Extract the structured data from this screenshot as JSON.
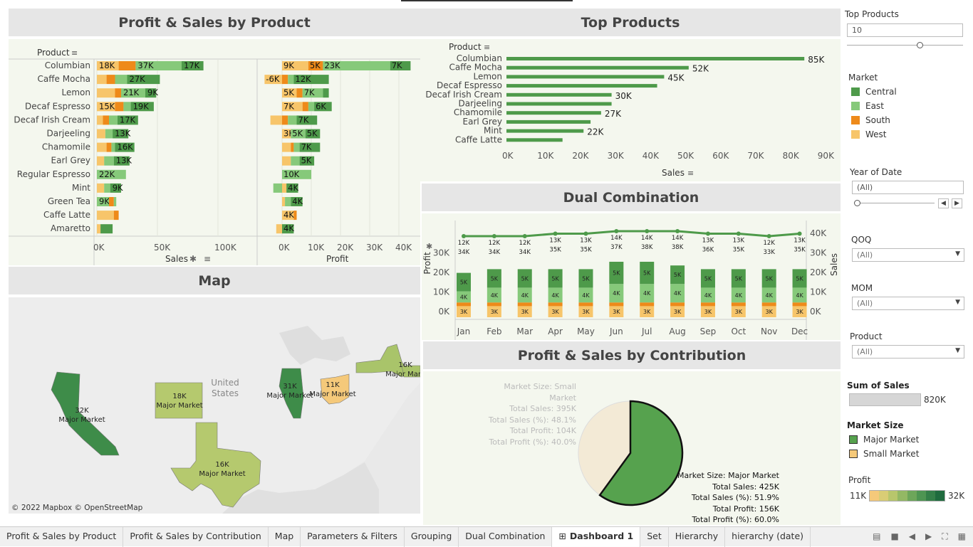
{
  "colors": {
    "central": "#4e9a4a",
    "east": "#86c97a",
    "south": "#ee8a1a",
    "west": "#f7c56a",
    "panel": "#f4f7ee",
    "title_bg": "#e6e6e6",
    "line": "#4e9a4a",
    "major": "#56a24e",
    "small": "#f3ead6"
  },
  "titles": {
    "profit_sales": "Profit & Sales by Product",
    "top_products": "Top Products",
    "map": "Map",
    "dual": "Dual Combination",
    "contribution": "Profit & Sales by Contribution"
  },
  "ps": {
    "product_header": "Product",
    "sales_axis": "Sales",
    "profit_axis": "Profit",
    "sales_ticks": [
      "0K",
      "50K",
      "100K"
    ],
    "profit_ticks": [
      "0K",
      "10K",
      "20K",
      "30K",
      "40K"
    ],
    "products": [
      {
        "name": "Columbian",
        "sales": [
          {
            "m": "west",
            "v": 18,
            "l": "18K"
          },
          {
            "m": "south",
            "v": 14,
            "l": ""
          },
          {
            "m": "east",
            "v": 38,
            "l": "37K"
          },
          {
            "m": "central",
            "v": 18,
            "l": "17K"
          }
        ],
        "profit": [
          {
            "m": "west",
            "v": 9,
            "l": "9K"
          },
          {
            "m": "south",
            "v": 5,
            "l": "5K"
          },
          {
            "m": "east",
            "v": 23,
            "l": "23K"
          },
          {
            "m": "central",
            "v": 7,
            "l": "7K"
          }
        ]
      },
      {
        "name": "Caffe Mocha",
        "sales": [
          {
            "m": "west",
            "v": 8,
            "l": ""
          },
          {
            "m": "south",
            "v": 7,
            "l": ""
          },
          {
            "m": "east",
            "v": 10,
            "l": ""
          },
          {
            "m": "central",
            "v": 27,
            "l": "27K"
          }
        ],
        "profit": [
          {
            "m": "west",
            "v": -6,
            "l": "-6K"
          },
          {
            "m": "south",
            "v": 2,
            "l": ""
          },
          {
            "m": "east",
            "v": 2,
            "l": ""
          },
          {
            "m": "central",
            "v": 12,
            "l": "12K"
          }
        ]
      },
      {
        "name": "Lemon",
        "sales": [
          {
            "m": "west",
            "v": 15,
            "l": ""
          },
          {
            "m": "south",
            "v": 5,
            "l": ""
          },
          {
            "m": "east",
            "v": 20,
            "l": "21K"
          },
          {
            "m": "central",
            "v": 9,
            "l": "9K"
          }
        ],
        "profit": [
          {
            "m": "west",
            "v": 5,
            "l": "5K"
          },
          {
            "m": "south",
            "v": 2,
            "l": ""
          },
          {
            "m": "east",
            "v": 7,
            "l": "7K"
          },
          {
            "m": "central",
            "v": 2,
            "l": ""
          }
        ]
      },
      {
        "name": "Decaf Espresso",
        "sales": [
          {
            "m": "west",
            "v": 15,
            "l": "15K"
          },
          {
            "m": "south",
            "v": 7,
            "l": ""
          },
          {
            "m": "east",
            "v": 6,
            "l": ""
          },
          {
            "m": "central",
            "v": 19,
            "l": "19K"
          }
        ],
        "profit": [
          {
            "m": "west",
            "v": 7,
            "l": "7K"
          },
          {
            "m": "south",
            "v": 2,
            "l": ""
          },
          {
            "m": "east",
            "v": 2,
            "l": ""
          },
          {
            "m": "central",
            "v": 6,
            "l": "6K"
          }
        ]
      },
      {
        "name": "Decaf Irish Cream",
        "sales": [
          {
            "m": "west",
            "v": 5,
            "l": ""
          },
          {
            "m": "south",
            "v": 5,
            "l": ""
          },
          {
            "m": "east",
            "v": 7,
            "l": ""
          },
          {
            "m": "central",
            "v": 17,
            "l": "17K"
          }
        ],
        "profit": [
          {
            "m": "west",
            "v": -4,
            "l": ""
          },
          {
            "m": "south",
            "v": 2,
            "l": ""
          },
          {
            "m": "east",
            "v": 3,
            "l": ""
          },
          {
            "m": "central",
            "v": 7,
            "l": "7K"
          }
        ]
      },
      {
        "name": "Darjeeling",
        "sales": [
          {
            "m": "west",
            "v": 7,
            "l": ""
          },
          {
            "m": "east",
            "v": 6,
            "l": ""
          },
          {
            "m": "central",
            "v": 13,
            "l": "13K"
          }
        ],
        "profit": [
          {
            "m": "west",
            "v": 3,
            "l": "3K"
          },
          {
            "m": "east",
            "v": 5,
            "l": "5K"
          },
          {
            "m": "central",
            "v": 5,
            "l": "5K"
          }
        ]
      },
      {
        "name": "Chamomile",
        "sales": [
          {
            "m": "west",
            "v": 8,
            "l": ""
          },
          {
            "m": "south",
            "v": 4,
            "l": ""
          },
          {
            "m": "east",
            "v": 3,
            "l": ""
          },
          {
            "m": "central",
            "v": 16,
            "l": "16K"
          }
        ],
        "profit": [
          {
            "m": "west",
            "v": 3,
            "l": ""
          },
          {
            "m": "south",
            "v": 1,
            "l": ""
          },
          {
            "m": "east",
            "v": 2,
            "l": ""
          },
          {
            "m": "central",
            "v": 7,
            "l": "7K"
          }
        ]
      },
      {
        "name": "Earl Grey",
        "sales": [
          {
            "m": "west",
            "v": 6,
            "l": ""
          },
          {
            "m": "east",
            "v": 8,
            "l": ""
          },
          {
            "m": "central",
            "v": 13,
            "l": "13K"
          }
        ],
        "profit": [
          {
            "m": "west",
            "v": 3,
            "l": ""
          },
          {
            "m": "east",
            "v": 3,
            "l": ""
          },
          {
            "m": "central",
            "v": 5,
            "l": "5K"
          }
        ]
      },
      {
        "name": "Regular Espresso",
        "sales": [
          {
            "m": "east",
            "v": 24,
            "l": "22K"
          }
        ],
        "profit": [
          {
            "m": "east",
            "v": 10,
            "l": "10K"
          }
        ]
      },
      {
        "name": "Mint",
        "sales": [
          {
            "m": "west",
            "v": 6,
            "l": ""
          },
          {
            "m": "east",
            "v": 5,
            "l": ""
          },
          {
            "m": "central",
            "v": 9,
            "l": "9K"
          }
        ],
        "profit": [
          {
            "m": "east",
            "v": -3,
            "l": ""
          },
          {
            "m": "west",
            "v": 1.5,
            "l": ""
          },
          {
            "m": "central",
            "v": 4,
            "l": "4K"
          }
        ]
      },
      {
        "name": "Green Tea",
        "sales": [
          {
            "m": "east",
            "v": 10,
            "l": "9K"
          },
          {
            "m": "south",
            "v": 4,
            "l": ""
          },
          {
            "m": "east",
            "v": 2,
            "l": ""
          }
        ],
        "profit": [
          {
            "m": "west",
            "v": 1,
            "l": ""
          },
          {
            "m": "east",
            "v": 2,
            "l": ""
          },
          {
            "m": "central",
            "v": 4,
            "l": "4K"
          }
        ]
      },
      {
        "name": "Caffe Latte",
        "sales": [
          {
            "m": "west",
            "v": 14,
            "l": ""
          },
          {
            "m": "south",
            "v": 4,
            "l": ""
          }
        ],
        "profit": [
          {
            "m": "west",
            "v": 4,
            "l": "4K"
          },
          {
            "m": "south",
            "v": 1,
            "l": ""
          }
        ]
      },
      {
        "name": "Amaretto",
        "sales": [
          {
            "m": "west",
            "v": 3,
            "l": ""
          },
          {
            "m": "central",
            "v": 10,
            "l": ""
          }
        ],
        "profit": [
          {
            "m": "west",
            "v": -2,
            "l": ""
          },
          {
            "m": "central",
            "v": 4,
            "l": "4K"
          }
        ]
      }
    ]
  },
  "top": {
    "product_header": "Product",
    "sales_axis": "Sales",
    "ticks": [
      "0K",
      "10K",
      "20K",
      "30K",
      "40K",
      "50K",
      "60K",
      "70K",
      "80K",
      "90K"
    ],
    "items": [
      {
        "name": "Columbian",
        "v": 85,
        "l": "85K"
      },
      {
        "name": "Caffe Mocha",
        "v": 52,
        "l": "52K"
      },
      {
        "name": "Lemon",
        "v": 45,
        "l": "45K"
      },
      {
        "name": "Decaf Espresso",
        "v": 43,
        "l": ""
      },
      {
        "name": "Decaf Irish Cream",
        "v": 30,
        "l": "30K"
      },
      {
        "name": "Darjeeling",
        "v": 30,
        "l": ""
      },
      {
        "name": "Chamomile",
        "v": 27,
        "l": "27K"
      },
      {
        "name": "Earl Grey",
        "v": 24,
        "l": ""
      },
      {
        "name": "Mint",
        "v": 22,
        "l": "22K"
      },
      {
        "name": "Caffe Latte",
        "v": 16,
        "l": ""
      }
    ]
  },
  "map": {
    "copyright": "© 2022 Mapbox © OpenStreetMap",
    "country_label": "United States",
    "states": [
      {
        "val": "32K",
        "sub": "Major Market"
      },
      {
        "val": "18K",
        "sub": "Major Market"
      },
      {
        "val": "16K",
        "sub": "Major Market"
      },
      {
        "val": "31K",
        "sub": "Major Market"
      },
      {
        "val": "11K",
        "sub": "Major Market"
      },
      {
        "val": "16K",
        "sub": "Major Mark"
      }
    ]
  },
  "dual": {
    "left_axis": "Profit",
    "right_axis": "Sales",
    "left_ticks": [
      "0K",
      "10K",
      "20K",
      "30K"
    ],
    "right_ticks": [
      "0K",
      "10K",
      "20K",
      "30K",
      "40K"
    ],
    "months": [
      "Jan",
      "Feb",
      "Mar",
      "Apr",
      "May",
      "Jun",
      "Jul",
      "Aug",
      "Sep",
      "Oct",
      "Nov",
      "Dec"
    ],
    "profit_labels": [
      "12K",
      "12K",
      "12K",
      "13K",
      "13K",
      "14K",
      "14K",
      "14K",
      "13K",
      "13K",
      "12K",
      "13K"
    ],
    "sales_labels": [
      "34K",
      "34K",
      "34K",
      "35K",
      "35K",
      "37K",
      "38K",
      "38K",
      "36K",
      "35K",
      "33K",
      "35K"
    ],
    "profit_line": [
      12,
      12,
      12,
      13,
      13,
      14,
      14,
      14,
      13,
      13,
      12,
      13
    ],
    "bar_labels": {
      "central": "5K",
      "east": "4K",
      "west": "3K"
    },
    "bars": [
      [
        5,
        3,
        1,
        3
      ],
      [
        5,
        4,
        1,
        3
      ],
      [
        5,
        4,
        1,
        3
      ],
      [
        5,
        4,
        1,
        3
      ],
      [
        5,
        4,
        1,
        3
      ],
      [
        6,
        5,
        1,
        3
      ],
      [
        6,
        5,
        1,
        3
      ],
      [
        5,
        5,
        1,
        3
      ],
      [
        5,
        4,
        1,
        3
      ],
      [
        5,
        4,
        1,
        3
      ],
      [
        5,
        4,
        1,
        3
      ],
      [
        5,
        4,
        1,
        3
      ]
    ]
  },
  "contrib": {
    "small": {
      "size": "Market Size: Small Market",
      "sales": "Total Sales: 395K",
      "sales_pct": "Total Sales (%): 48.1%",
      "profit": "Total Profit: 104K",
      "profit_pct": "Total Profit (%): 40.0%"
    },
    "major": {
      "size": "Market Size: Major Market",
      "sales": "Total Sales: 425K",
      "sales_pct": "Total Sales (%): 51.9%",
      "profit": "Total Profit: 156K",
      "profit_pct": "Total Profit (%): 60.0%"
    },
    "pie": [
      {
        "label": "Major Market",
        "pct": 60.0
      },
      {
        "label": "Small Market",
        "pct": 40.0
      }
    ]
  },
  "sidebar": {
    "top_products_label": "Top Products",
    "top_products_value": "10",
    "top_products_slider": 0.65,
    "market_label": "Market",
    "markets": [
      "Central",
      "East",
      "South",
      "West"
    ],
    "year_label": "Year of Date",
    "year_value": "(All)",
    "qoq_label": "QOQ",
    "qoq_value": "(All)",
    "mom_label": "MOM",
    "mom_value": "(All)",
    "product_label": "Product",
    "product_value": "(All)",
    "sum_sales_label": "Sum of Sales",
    "sum_sales_value": "820K",
    "market_size_label": "Market Size",
    "market_sizes": [
      "Major Market",
      "Small Market"
    ],
    "profit_label": "Profit",
    "profit_min": "11K",
    "profit_max": "32K"
  },
  "tabs": [
    "Profit & Sales by Product",
    "Profit & Sales by Contribution",
    "Map",
    "Parameters & Filters",
    "Grouping",
    "Dual Combination",
    "Dashboard 1",
    "Set",
    "Hierarchy",
    "hierarchy (date)"
  ],
  "active_tab": "Dashboard 1"
}
